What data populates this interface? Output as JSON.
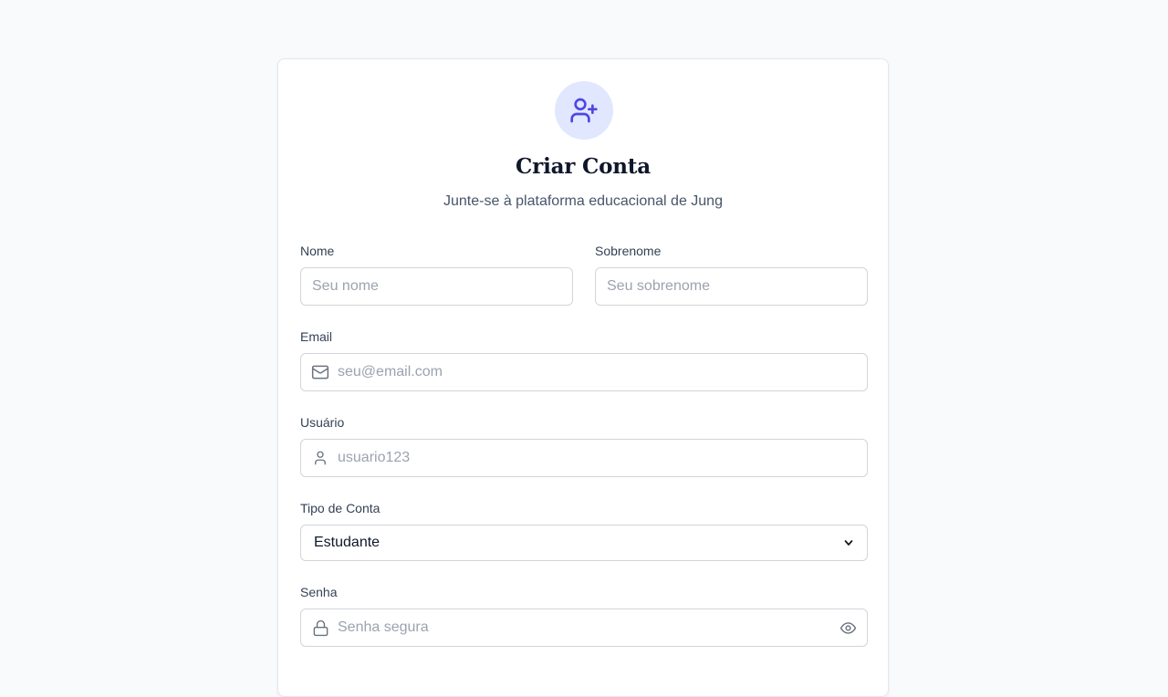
{
  "header": {
    "title": "Criar Conta",
    "subtitle": "Junte-se à plataforma educacional de Jung",
    "icon": "user-plus-icon"
  },
  "form": {
    "first_name": {
      "label": "Nome",
      "placeholder": "Seu nome",
      "value": ""
    },
    "last_name": {
      "label": "Sobrenome",
      "placeholder": "Seu sobrenome",
      "value": ""
    },
    "email": {
      "label": "Email",
      "placeholder": "seu@email.com",
      "value": "",
      "icon": "mail-icon"
    },
    "username": {
      "label": "Usuário",
      "placeholder": "usuario123",
      "value": "",
      "icon": "user-icon"
    },
    "account_type": {
      "label": "Tipo de Conta",
      "selected": "Estudante",
      "icon": "chevron-down-icon"
    },
    "password": {
      "label": "Senha",
      "placeholder": "Senha segura",
      "value": "",
      "icon": "lock-icon",
      "toggle_icon": "eye-icon"
    }
  },
  "colors": {
    "accent": "#4f46e5",
    "accent_bg": "#e0e7ff",
    "page_bg": "#f8fafc",
    "border": "#d1d5db",
    "placeholder": "#9ca3af"
  }
}
